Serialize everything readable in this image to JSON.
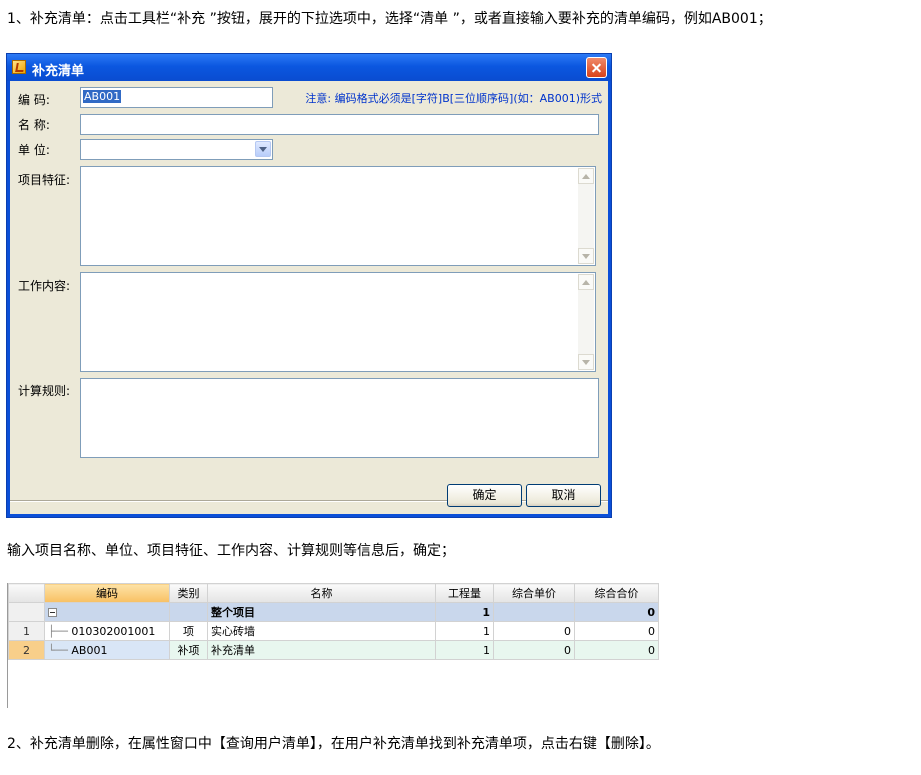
{
  "paragraphs": {
    "step1": "1、补充清单：点击工具栏“补充 ”按钮，展开的下拉选项中，选择“清单 ”，或者直接输入要补充的清单编码，例如AB001；",
    "step1b": "输入项目名称、单位、项目特征、工作内容、计算规则等信息后，确定；",
    "step2": "2、补充清单删除，在属性窗口中【查询用户清单】，在用户补充清单找到补充清单项，点击右键【删除】。"
  },
  "dialog": {
    "title": "补充清单",
    "labels": {
      "code": "编    码:",
      "name": "名    称:",
      "unit": "单    位:",
      "features": "项目特征:",
      "work": "工作内容:",
      "rules": "计算规则:"
    },
    "code_value": "AB001",
    "name_value": "",
    "unit_value": "",
    "note": "注意: 编码格式必须是[字符]B[三位顺序码](如：AB001)形式",
    "ok_label": "确定",
    "cancel_label": "取消"
  },
  "grid": {
    "columns": [
      "编码",
      "类别",
      "名称",
      "工程量",
      "综合单价",
      "综合合价"
    ],
    "group_row": {
      "name": "整个项目",
      "qty": "1",
      "total": "0"
    },
    "rows": [
      {
        "index": "1",
        "code": "010302001001",
        "type": "项",
        "name": "实心砖墙",
        "qty": "1",
        "price": "0",
        "total": "0"
      },
      {
        "index": "2",
        "code": "AB001",
        "type": "补项",
        "name": "补充清单",
        "qty": "1",
        "price": "0",
        "total": "0"
      }
    ]
  },
  "colors": {
    "title_bar": "#0b57e0",
    "dialog_face": "#ece9d8",
    "note_text": "#0033cc",
    "group_row": "#c9d7ec"
  }
}
